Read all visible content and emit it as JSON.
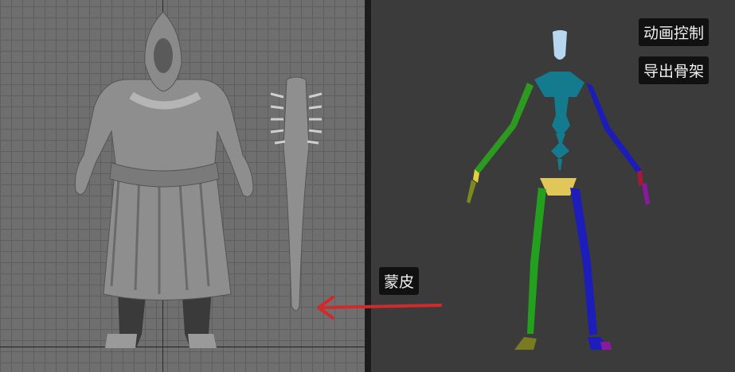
{
  "buttons": {
    "animation_control": "动画控制",
    "export_skeleton": "导出骨架"
  },
  "annotations": {
    "skin_label": "蒙皮"
  },
  "colors": {
    "arrow": "#d02a2a",
    "left_arm": "#2c9a1e",
    "right_arm": "#1c1cb8",
    "left_leg": "#23a01d",
    "right_leg": "#1d1dba",
    "spine": "#147b8f",
    "head": "#b8d6f0",
    "pelvis": "#e1c65a"
  }
}
